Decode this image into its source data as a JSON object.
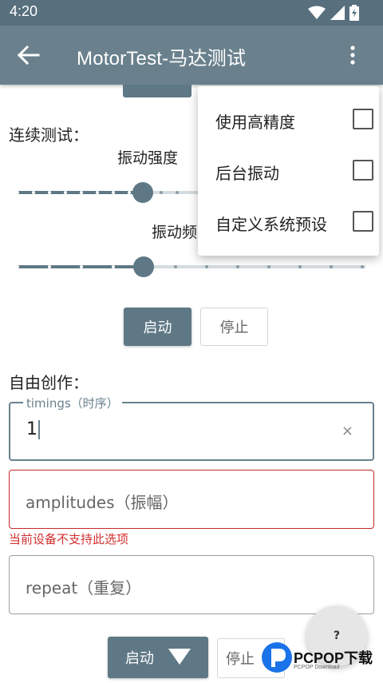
{
  "status_bar": {
    "time": "4:20"
  },
  "app_bar": {
    "title": "MotorTest-马达测试"
  },
  "continuous": {
    "section_label": "连续测试：",
    "strength_label": "振动强度",
    "frequency_label": "振动频",
    "strength_level": 0.36,
    "frequency_level": 0.36,
    "start_label": "启动",
    "stop_label": "停止"
  },
  "free": {
    "section_label": "自由创作：",
    "timings": {
      "label": "timings（时序）",
      "value": "1",
      "clear": "×"
    },
    "amplitudes": {
      "placeholder": "amplitudes（振幅）"
    },
    "error_text": "当前设备不支持此选项",
    "repeat": {
      "placeholder": "repeat（重复）"
    },
    "start_label": "启动",
    "stop_label": "停止"
  },
  "fab": {
    "label": "?"
  },
  "overflow_menu": {
    "items": [
      {
        "label": "使用高精度",
        "checked": false
      },
      {
        "label": "后台振动",
        "checked": false
      },
      {
        "label": "自定义系统预设",
        "checked": false
      }
    ]
  },
  "watermark": {
    "text": "PCPOP下载",
    "sub": "PCPOP Download"
  },
  "colors": {
    "appbar": "#6a818d",
    "statusbar": "#58707e",
    "button": "#5f7885",
    "error": "#d32f2f"
  }
}
